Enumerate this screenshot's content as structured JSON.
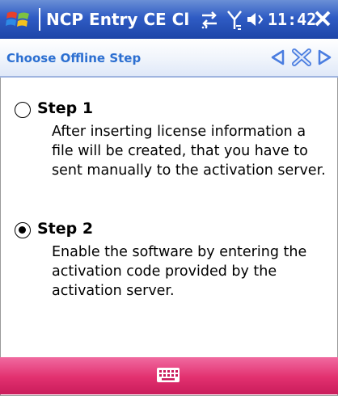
{
  "titlebar": {
    "app_title": "NCP Entry CE Cl",
    "time": "11:42"
  },
  "header": {
    "title": "Choose Offline Step"
  },
  "options": [
    {
      "title": "Step 1",
      "description": "After inserting license information a file will be created, that you have to sent manually to the activation server.",
      "selected": false
    },
    {
      "title": "Step 2",
      "description": "Enable the software by entering the activation code provided by the activation server.",
      "selected": true
    }
  ],
  "colors": {
    "titlebar": "#2f5cc4",
    "header_text": "#2c6fd1",
    "bottombar": "#e2306f"
  },
  "icons": [
    "windows-start-icon",
    "connectivity-icon",
    "signal-icon",
    "volume-icon",
    "close-icon",
    "back-arrow-icon",
    "cancel-icon",
    "forward-arrow-icon",
    "keyboard-icon"
  ]
}
